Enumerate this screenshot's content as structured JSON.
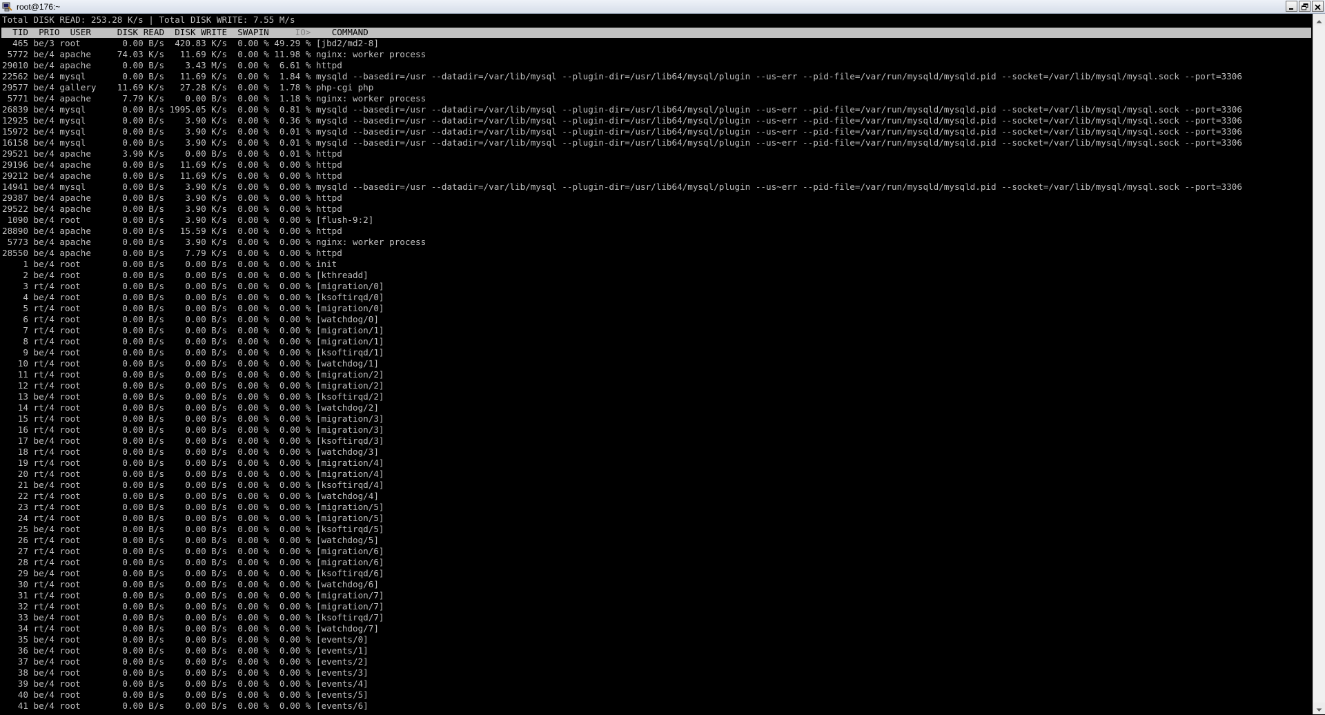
{
  "window": {
    "title": "root@176:~",
    "icons": {
      "app": "putty-terminal-icon",
      "minimize": "minimize-icon",
      "maximize": "restore-icon",
      "close": "close-icon"
    }
  },
  "terminal": {
    "summary": "Total DISK READ: 253.28 K/s | Total DISK WRITE: 7.55 M/s",
    "header": {
      "left": "  TID  PRIO  USER     DISK READ  DISK WRITE  SWAPIN     ",
      "io": "IO>",
      "right": "    COMMAND"
    },
    "rows": [
      "  465 be/3 root        0.00 B/s  420.83 K/s  0.00 % 49.29 % [jbd2/md2-8]",
      " 5772 be/4 apache     74.03 K/s   11.69 K/s  0.00 % 11.98 % nginx: worker process",
      "29010 be/4 apache      0.00 B/s    3.43 M/s  0.00 %  6.61 % httpd",
      "22562 be/4 mysql       0.00 B/s   11.69 K/s  0.00 %  1.84 % mysqld --basedir=/usr --datadir=/var/lib/mysql --plugin-dir=/usr/lib64/mysql/plugin --us~err --pid-file=/var/run/mysqld/mysqld.pid --socket=/var/lib/mysql/mysql.sock --port=3306",
      "29577 be/4 gallery    11.69 K/s   27.28 K/s  0.00 %  1.78 % php-cgi php",
      " 5771 be/4 apache      7.79 K/s    0.00 B/s  0.00 %  1.18 % nginx: worker process",
      "26839 be/4 mysql       0.00 B/s 1995.05 K/s  0.00 %  0.81 % mysqld --basedir=/usr --datadir=/var/lib/mysql --plugin-dir=/usr/lib64/mysql/plugin --us~err --pid-file=/var/run/mysqld/mysqld.pid --socket=/var/lib/mysql/mysql.sock --port=3306",
      "12925 be/4 mysql       0.00 B/s    3.90 K/s  0.00 %  0.36 % mysqld --basedir=/usr --datadir=/var/lib/mysql --plugin-dir=/usr/lib64/mysql/plugin --us~err --pid-file=/var/run/mysqld/mysqld.pid --socket=/var/lib/mysql/mysql.sock --port=3306",
      "15972 be/4 mysql       0.00 B/s    3.90 K/s  0.00 %  0.01 % mysqld --basedir=/usr --datadir=/var/lib/mysql --plugin-dir=/usr/lib64/mysql/plugin --us~err --pid-file=/var/run/mysqld/mysqld.pid --socket=/var/lib/mysql/mysql.sock --port=3306",
      "16158 be/4 mysql       0.00 B/s    3.90 K/s  0.00 %  0.01 % mysqld --basedir=/usr --datadir=/var/lib/mysql --plugin-dir=/usr/lib64/mysql/plugin --us~err --pid-file=/var/run/mysqld/mysqld.pid --socket=/var/lib/mysql/mysql.sock --port=3306",
      "29521 be/4 apache      3.90 K/s    0.00 B/s  0.00 %  0.01 % httpd",
      "29196 be/4 apache      0.00 B/s   11.69 K/s  0.00 %  0.00 % httpd",
      "29212 be/4 apache      0.00 B/s   11.69 K/s  0.00 %  0.00 % httpd",
      "14941 be/4 mysql       0.00 B/s    3.90 K/s  0.00 %  0.00 % mysqld --basedir=/usr --datadir=/var/lib/mysql --plugin-dir=/usr/lib64/mysql/plugin --us~err --pid-file=/var/run/mysqld/mysqld.pid --socket=/var/lib/mysql/mysql.sock --port=3306",
      "29387 be/4 apache      0.00 B/s    3.90 K/s  0.00 %  0.00 % httpd",
      "29522 be/4 apache      0.00 B/s    3.90 K/s  0.00 %  0.00 % httpd",
      " 1090 be/4 root        0.00 B/s    3.90 K/s  0.00 %  0.00 % [flush-9:2]",
      "28890 be/4 apache      0.00 B/s   15.59 K/s  0.00 %  0.00 % httpd",
      " 5773 be/4 apache      0.00 B/s    3.90 K/s  0.00 %  0.00 % nginx: worker process",
      "28550 be/4 apache      0.00 B/s    7.79 K/s  0.00 %  0.00 % httpd",
      "    1 be/4 root        0.00 B/s    0.00 B/s  0.00 %  0.00 % init",
      "    2 be/4 root        0.00 B/s    0.00 B/s  0.00 %  0.00 % [kthreadd]",
      "    3 rt/4 root        0.00 B/s    0.00 B/s  0.00 %  0.00 % [migration/0]",
      "    4 be/4 root        0.00 B/s    0.00 B/s  0.00 %  0.00 % [ksoftirqd/0]",
      "    5 rt/4 root        0.00 B/s    0.00 B/s  0.00 %  0.00 % [migration/0]",
      "    6 rt/4 root        0.00 B/s    0.00 B/s  0.00 %  0.00 % [watchdog/0]",
      "    7 rt/4 root        0.00 B/s    0.00 B/s  0.00 %  0.00 % [migration/1]",
      "    8 rt/4 root        0.00 B/s    0.00 B/s  0.00 %  0.00 % [migration/1]",
      "    9 be/4 root        0.00 B/s    0.00 B/s  0.00 %  0.00 % [ksoftirqd/1]",
      "   10 rt/4 root        0.00 B/s    0.00 B/s  0.00 %  0.00 % [watchdog/1]",
      "   11 rt/4 root        0.00 B/s    0.00 B/s  0.00 %  0.00 % [migration/2]",
      "   12 rt/4 root        0.00 B/s    0.00 B/s  0.00 %  0.00 % [migration/2]",
      "   13 be/4 root        0.00 B/s    0.00 B/s  0.00 %  0.00 % [ksoftirqd/2]",
      "   14 rt/4 root        0.00 B/s    0.00 B/s  0.00 %  0.00 % [watchdog/2]",
      "   15 rt/4 root        0.00 B/s    0.00 B/s  0.00 %  0.00 % [migration/3]",
      "   16 rt/4 root        0.00 B/s    0.00 B/s  0.00 %  0.00 % [migration/3]",
      "   17 be/4 root        0.00 B/s    0.00 B/s  0.00 %  0.00 % [ksoftirqd/3]",
      "   18 rt/4 root        0.00 B/s    0.00 B/s  0.00 %  0.00 % [watchdog/3]",
      "   19 rt/4 root        0.00 B/s    0.00 B/s  0.00 %  0.00 % [migration/4]",
      "   20 rt/4 root        0.00 B/s    0.00 B/s  0.00 %  0.00 % [migration/4]",
      "   21 be/4 root        0.00 B/s    0.00 B/s  0.00 %  0.00 % [ksoftirqd/4]",
      "   22 rt/4 root        0.00 B/s    0.00 B/s  0.00 %  0.00 % [watchdog/4]",
      "   23 rt/4 root        0.00 B/s    0.00 B/s  0.00 %  0.00 % [migration/5]",
      "   24 rt/4 root        0.00 B/s    0.00 B/s  0.00 %  0.00 % [migration/5]",
      "   25 be/4 root        0.00 B/s    0.00 B/s  0.00 %  0.00 % [ksoftirqd/5]",
      "   26 rt/4 root        0.00 B/s    0.00 B/s  0.00 %  0.00 % [watchdog/5]",
      "   27 rt/4 root        0.00 B/s    0.00 B/s  0.00 %  0.00 % [migration/6]",
      "   28 rt/4 root        0.00 B/s    0.00 B/s  0.00 %  0.00 % [migration/6]",
      "   29 be/4 root        0.00 B/s    0.00 B/s  0.00 %  0.00 % [ksoftirqd/6]",
      "   30 rt/4 root        0.00 B/s    0.00 B/s  0.00 %  0.00 % [watchdog/6]",
      "   31 rt/4 root        0.00 B/s    0.00 B/s  0.00 %  0.00 % [migration/7]",
      "   32 rt/4 root        0.00 B/s    0.00 B/s  0.00 %  0.00 % [migration/7]",
      "   33 be/4 root        0.00 B/s    0.00 B/s  0.00 %  0.00 % [ksoftirqd/7]",
      "   34 rt/4 root        0.00 B/s    0.00 B/s  0.00 %  0.00 % [watchdog/7]",
      "   35 be/4 root        0.00 B/s    0.00 B/s  0.00 %  0.00 % [events/0]",
      "   36 be/4 root        0.00 B/s    0.00 B/s  0.00 %  0.00 % [events/1]",
      "   37 be/4 root        0.00 B/s    0.00 B/s  0.00 %  0.00 % [events/2]",
      "   38 be/4 root        0.00 B/s    0.00 B/s  0.00 %  0.00 % [events/3]",
      "   39 be/4 root        0.00 B/s    0.00 B/s  0.00 %  0.00 % [events/4]",
      "   40 be/4 root        0.00 B/s    0.00 B/s  0.00 %  0.00 % [events/5]",
      "   41 be/4 root        0.00 B/s    0.00 B/s  0.00 %  0.00 % [events/6]"
    ]
  }
}
